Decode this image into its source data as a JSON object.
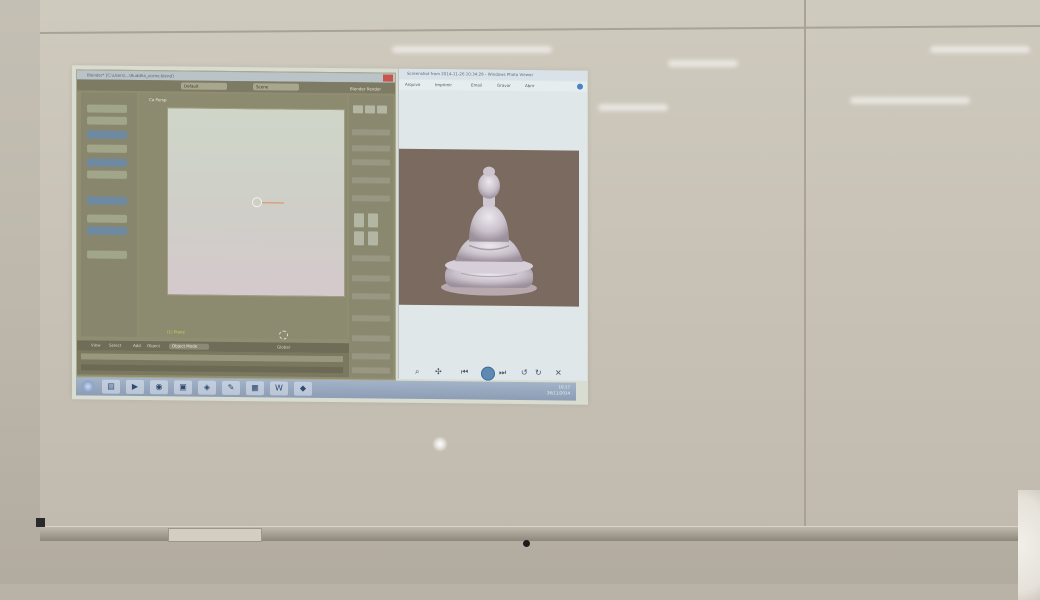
{
  "scene": {
    "description_type": "photo of projected desktop on whiteboard"
  },
  "blender": {
    "title": "Blender* [C:\\Users\\...\\Buddha_scene.blend]",
    "header_fields": [
      "Default",
      "Scene"
    ],
    "render_engine": "Blender Render",
    "view_label": "Ca Persp",
    "layer_label": "(1) Plane",
    "mode": "Object Mode",
    "menus": [
      "View",
      "Select",
      "Add",
      "Object"
    ],
    "pivot": "Global"
  },
  "viewer": {
    "title": "Screenshot from 2014-11-26 10:34:29 - Windows Photo Viewer",
    "menu": [
      "Arquivo",
      "Imprimir",
      "Email",
      "Gravar",
      "Abrir"
    ]
  },
  "taskbar": {
    "clock_time": "10:17",
    "clock_date": "26/11/2014",
    "apps": [
      "folder",
      "media",
      "chrome",
      "photo",
      "blender",
      "paint",
      "explorer",
      "word",
      "tool"
    ]
  },
  "colors": {
    "whiteboard": "#cbc5b9",
    "blender_bg": "#8f8e72",
    "viewer_bg": "#dfe7e8",
    "photo_bg": "#7a6a5f",
    "statue": "#d8d2da",
    "taskbar": "#98a8bf"
  }
}
